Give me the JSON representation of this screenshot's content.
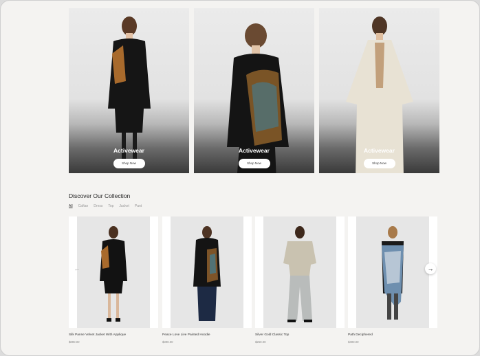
{
  "hero": {
    "cards": [
      {
        "title": "Activewear",
        "button": "Shop Now"
      },
      {
        "title": "Activewear",
        "button": "Shop Now"
      },
      {
        "title": "Activewear",
        "button": "Shop Now"
      }
    ]
  },
  "collection": {
    "title": "Discover Our Collection",
    "filters": [
      "All",
      "Caftan",
      "Dress",
      "Top",
      "Jacket",
      "Pant"
    ],
    "active_filter": "All",
    "products": [
      {
        "name": "Silk Panne Velvet Jacket With Applique",
        "price": "$890.00"
      },
      {
        "name": "Peace Love Live Painted Hoodie",
        "price": "$390.00"
      },
      {
        "name": "Silver Gold Classic Top",
        "price": "$250.00"
      },
      {
        "name": "Path Deciphered",
        "price": "$490.00"
      }
    ],
    "prev_arrow": "←",
    "next_arrow": "→"
  }
}
